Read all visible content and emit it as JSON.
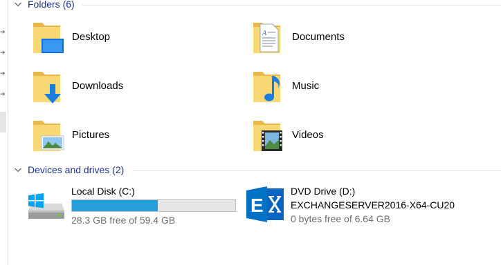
{
  "folders_group": {
    "title": "Folders (6)",
    "items": [
      {
        "label": "Desktop",
        "icon": "desktop-folder-icon"
      },
      {
        "label": "Documents",
        "icon": "documents-folder-icon"
      },
      {
        "label": "Downloads",
        "icon": "downloads-folder-icon"
      },
      {
        "label": "Music",
        "icon": "music-folder-icon"
      },
      {
        "label": "Pictures",
        "icon": "pictures-folder-icon"
      },
      {
        "label": "Videos",
        "icon": "videos-folder-icon"
      }
    ]
  },
  "devices_group": {
    "title": "Devices and drives (2)",
    "drives": [
      {
        "name": "Local Disk (C:)",
        "free_text": "28.3 GB free of 59.4 GB",
        "used_fraction": 0.524,
        "icon": "windows-drive-icon"
      },
      {
        "name": "DVD Drive (D:)",
        "volume_label": "EXCHANGESERVER2016-X64-CU20",
        "free_text": "0 bytes free of 6.64 GB",
        "icon": "exchange-dvd-icon"
      }
    ]
  },
  "colors": {
    "group_title": "#1e3287",
    "usage_bar": "#26a0da",
    "folder": "#f8d775"
  }
}
